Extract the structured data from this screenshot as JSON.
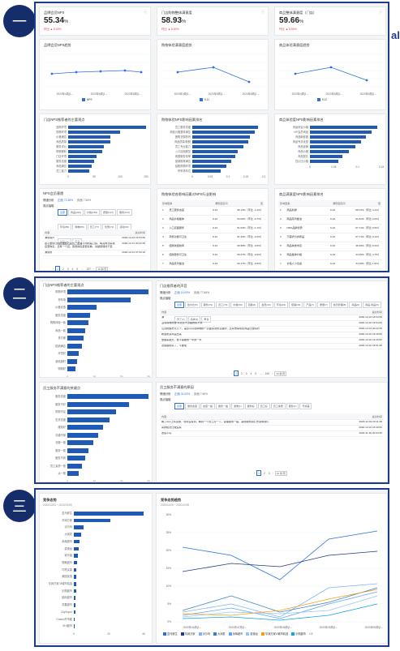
{
  "badges": [
    "一",
    "二",
    "三"
  ],
  "edge_glyph": "al",
  "s1": {
    "kpis": [
      {
        "title": "品牌会员NPS",
        "value": "55.34",
        "delta": "%",
        "change": "环比 ▲ 8.50%"
      },
      {
        "title": "门店购物整体满意度",
        "value": "58.93",
        "delta": "%",
        "change": "环比 ▲ 8.50%"
      },
      {
        "title": "商品整体满意度（门店）",
        "value": "59.66",
        "delta": "%",
        "change": "环比 ▲ 8.50%"
      }
    ],
    "trends": [
      {
        "title": "品牌会员NPS趋势",
        "legend": "NPS",
        "ticks": [
          "2020年4周(1...",
          "2020年6周(1...",
          "2020年8周(1..."
        ]
      },
      {
        "title": "购物体验满意度趋势",
        "legend": "9-10",
        "ticks": [
          "2020年4周(1...",
          "2020年6周(1...",
          "2020年8周(1..."
        ]
      },
      {
        "title": "商品体验满意度趋势",
        "legend": "9-10",
        "ticks": [
          "2020年4周(1...",
          "2020年6周(1...",
          "2020年8周(1..."
        ]
      }
    ],
    "bars": [
      {
        "title": "门店NPS推荐者的主要观点",
        "items": [
          {
            "l": "选购环境",
            "v": 100
          },
          {
            "l": "购物环境",
            "v": 67
          },
          {
            "l": "价格满意",
            "v": 54
          },
          {
            "l": "商品质量",
            "v": 54
          },
          {
            "l": "服务评价",
            "v": 46
          },
          {
            "l": "购物便利",
            "v": 44
          },
          {
            "l": "门店环境",
            "v": 36
          },
          {
            "l": "服务态度",
            "v": 33
          },
          {
            "l": "商品满意",
            "v": 30
          },
          {
            "l": "员工能力",
            "v": 27
          }
        ],
        "ticks": [
          "0",
          "50",
          "100",
          "150"
        ]
      },
      {
        "title": "购物体验NPS影响因素排名",
        "items": [
          {
            "l": "员工服务态度",
            "v": 92
          },
          {
            "l": "商品价格整体满意",
            "v": 88
          },
          {
            "l": "团购货架陈列",
            "v": 81
          },
          {
            "l": "商品质量/新鲜",
            "v": 78
          },
          {
            "l": "员工专业能力",
            "v": 72
          },
          {
            "l": "入口店面服务",
            "v": 64
          },
          {
            "l": "收银服务效率",
            "v": 60
          },
          {
            "l": "促销推荐满意",
            "v": 54
          },
          {
            "l": "结账购物环境",
            "v": 48
          },
          {
            "l": "停车场车位",
            "v": 40
          }
        ],
        "ticks": [
          "0",
          "0.05",
          "0.1",
          "0.15",
          "0.2"
        ]
      },
      {
        "title": "商品体验度NPS影响因素排名",
        "items": [
          {
            "l": "商品综合价格",
            "v": 94
          },
          {
            "l": "VIP会员商品",
            "v": 86
          },
          {
            "l": "商品新鲜度",
            "v": 78
          },
          {
            "l": "商品专享优惠",
            "v": 72
          },
          {
            "l": "商品促销",
            "v": 64
          },
          {
            "l": "商品价格",
            "v": 55
          },
          {
            "l": "商品配比",
            "v": 46
          },
          {
            "l": "性价比价格",
            "v": 40
          }
        ],
        "ticks": [
          "0",
          "0.05",
          "0.1",
          "0.15"
        ]
      }
    ],
    "voice": {
      "title": "NPS会员意愿",
      "radio_label": "情绪分析",
      "r1": "正面 72.38%",
      "r2": "负面 7.54%",
      "filter_label": "观点抽取",
      "tags": [
        "全部",
        "商品(224)",
        "价格(184)",
        "质量(127)",
        "服务(114)",
        "环境(89)",
        "购物(86)",
        "员工(77)",
        "优惠(72)",
        "活动(60)",
        "体验(54)",
        "更多"
      ],
      "headers": [
        "内容",
        "提交时间"
      ],
      "rows": [
        [
          "满意客户",
          "2020-12-03 19:53:36"
        ],
        [
          "最心爱的比利时国旗巧克力，最有不同的是口感，喝完再次来我店里购买，还有一个店，我觉得包装很好看，请继续保持不变",
          "2020-12-01 20:22:35"
        ],
        [
          "满意的",
          "2020-12-01 07:52:10"
        ]
      ],
      "pages": [
        "1",
        "2",
        "3",
        "4",
        "5",
        "...",
        "237"
      ],
      "page_size": "10 条/页"
    },
    "tables": [
      {
        "title": "购物体验各影响因素对NPS行业影响",
        "headers": [
          "影响因素",
          "满意度区间",
          "值"
        ],
        "rows": [
          [
            "1",
            "员工服务态度",
            "9-10",
            "55.13%（环比 -1.2%）"
          ],
          [
            "2",
            "商品价格整体",
            "9-10",
            "54.06%（环比 -0.7%）"
          ],
          [
            "3",
            "入口店面服务",
            "9-10",
            "51.63%（环比 -1.1%）"
          ],
          [
            "4",
            "商务功能可卫生",
            "9-10",
            "51.32%（环比 -2.0%）"
          ],
          [
            "5",
            "结账收银效率",
            "9-10",
            "50.98%（环比 -0.6%）"
          ],
          [
            "6",
            "结账服务可卫生",
            "9-10",
            "50.27%（环比 -0.9%）"
          ],
          [
            "7",
            "商品陈列整洁",
            "9-10",
            "50.17%（环比 -0.9%）"
          ]
        ]
      },
      {
        "title": "商品满意度NPS影响因素排名",
        "headers": [
          "影响因素",
          "满意度区间",
          "值"
        ],
        "rows": [
          [
            "1",
            "商品新鲜",
            "9-10",
            "68.72%（环比 4.1%）"
          ],
          [
            "2",
            "商品陈列整洁",
            "9-10",
            "61.82%（环比 2.0%）"
          ],
          [
            "3",
            "NMS品牌优势",
            "9-10",
            "67.71%（环比 0.9%）"
          ],
          [
            "4",
            "不需折价的商品",
            "9-10",
            "67.71%（环比 0.1%）"
          ],
          [
            "5",
            "商品种类丰富",
            "9-10",
            "46.46%（环比 6.4%）"
          ],
          [
            "6",
            "商品整体价格",
            "9-10",
            "44.40%（环比 4.7%）"
          ],
          [
            "7",
            "价格人小合适",
            "9-10",
            "34.18%（环比 1.5%）"
          ]
        ]
      }
    ]
  },
  "s2": {
    "bars": [
      {
        "title": "门店NPS推荐者的主要观点",
        "items": [
          {
            "l": "购物环境",
            "v": 100
          },
          {
            "l": "停车场",
            "v": 78
          },
          {
            "l": "价格优惠",
            "v": 36
          },
          {
            "l": "服务态度",
            "v": 28
          },
          {
            "l": "购物体验一致",
            "v": 26
          },
          {
            "l": "商品一致",
            "v": 22
          },
          {
            "l": "多方便",
            "v": 20
          },
          {
            "l": "促销满意",
            "v": 18
          },
          {
            "l": "环境好",
            "v": 14
          },
          {
            "l": "营收超时",
            "v": 12
          },
          {
            "l": "购物好",
            "v": 10
          }
        ],
        "ticks": [
          "0",
          "10",
          "20",
          "30"
        ]
      },
      {
        "title": "员工服务不满意的关键点",
        "items": [
          {
            "l": "服务态度",
            "v": 100
          },
          {
            "l": "服务不好",
            "v": 76
          },
          {
            "l": "购物不足",
            "v": 60
          },
          {
            "l": "售货态度",
            "v": 52
          },
          {
            "l": "服务好",
            "v": 44
          },
          {
            "l": "沟通不够",
            "v": 38
          },
          {
            "l": "流程一般",
            "v": 32
          },
          {
            "l": "服务一般",
            "v": 26
          },
          {
            "l": "服务不到",
            "v": 22
          },
          {
            "l": "员工素质一般",
            "v": 18
          },
          {
            "l": "太一般",
            "v": 14
          }
        ],
        "ticks": [
          "0",
          "10",
          "20",
          "30"
        ]
      }
    ],
    "voice1": {
      "title": "门店推荐者的声音",
      "radio_label": "情绪分析",
      "r1": "正面 14.93%",
      "r2": "负面 77.66%",
      "filter_label": "观点抽取",
      "tags": [
        "全部",
        "性价比(5)",
        "服务(73)",
        "员工(73)",
        "价格(59)",
        "自助(4)",
        "会员(16)",
        "环境(43)",
        "促销(39)",
        "产品(7)",
        "质量(7)",
        "会员管理(8)",
        "商品(6)",
        "商品-商品(5)",
        "员工(7)",
        "品牌(5)",
        "更多"
      ],
      "headers": [
        "内容",
        "提交时间"
      ],
      "rows": [
        [
          "满",
          "2020-12-02 18:53:36"
        ],
        [
          "没有购物质量 以及买不清楚的买不到",
          "2020-12-02 19:54:06"
        ],
        [
          "山顶的超市大几个，是否可以在购物的一点面多到更清楚的，还有觉得现在商品比较好的",
          "2020-12-01 20:22:35"
        ],
        [
          "希望更多商品出来",
          "2020-12-02 18:40:56"
        ],
        [
          "量越来越大，量不需要的一年的一半",
          "2020-12-02 19:40:52"
        ],
        [
          "这些都挺好了，不要啦",
          "2020-12-02 18:51:48"
        ]
      ],
      "pages": [
        "1",
        "2",
        "3",
        "4",
        "5",
        "...",
        "100"
      ],
      "page_size": "10 条/页"
    },
    "voice2": {
      "title": "员工服务不满意的原因",
      "radio_label": "情绪分析",
      "r1": "正面 31.63%",
      "r2": "负面 7.69%",
      "filter_label": "观点抽取",
      "tags": [
        "全部",
        "服务态度",
        "态度一般",
        "服务一般",
        "素质(1)",
        "服务好",
        "员工好",
        "员工素质",
        "服务(1)",
        "环境差"
      ],
      "headers": [
        "内容",
        "提交时间"
      ],
      "rows": [
        [
          "看了App上有兑换，现场没有到，看到一个员工问一下，说理服务一般，其他服务和打去说明我们",
          "2020-12-02 20:11:48"
        ],
        [
          "有的柜员比较没有",
          "2020-12-02 18:49:52"
        ],
        [
          "态度不好",
          "2020-11-30 20:03:36"
        ]
      ],
      "pages": [
        "1",
        "2",
        "3"
      ],
      "page_size": "10 条/页"
    }
  },
  "s3": {
    "bar": {
      "title": "竞争态势",
      "date": "2020/12/03 ~ 2020/12/09",
      "items": [
        {
          "l": "盒马鲜生",
          "v": 100
        },
        {
          "l": "华润万家",
          "v": 52
        },
        {
          "l": "沃尔玛",
          "v": 14
        },
        {
          "l": "大润发",
          "v": 10
        },
        {
          "l": "永辉超市",
          "v": 8
        },
        {
          "l": "麦德龙",
          "v": 7
        },
        {
          "l": "家乐福",
          "v": 6
        },
        {
          "l": "物美超市",
          "v": 5
        },
        {
          "l": "叮咚买菜",
          "v": 4
        },
        {
          "l": "美团优选",
          "v": 4
        },
        {
          "l": "华润万家-Vi城市精选",
          "v": 3
        },
        {
          "l": "乐购超市",
          "v": 3
        },
        {
          "l": "欧尚超市",
          "v": 2
        },
        {
          "l": "苏果超市",
          "v": 2
        },
        {
          "l": "CitySuper",
          "v": 2
        },
        {
          "l": "Costco开市客",
          "v": 1
        },
        {
          "l": "SHI超市",
          "v": 1
        }
      ],
      "ticks": [
        "0",
        "20",
        "40"
      ]
    },
    "line": {
      "title": "竞争态势趋势",
      "date": "2020/11/09 ~ 2020/12/09",
      "yticks": [
        "30%",
        "25%",
        "20%",
        "15%",
        "10%",
        "5%",
        "0%"
      ],
      "xticks": [
        "2020年44周(1...",
        "2020年47周(1...",
        "2020年48周(1...",
        "2020年49周(1...",
        "2020年50周(1..."
      ],
      "legend": [
        "盒马鲜生",
        "华润万家",
        "沃尔玛",
        "大润发",
        "永辉超市",
        "麦德龙",
        "华润万家Vi城市精选",
        "乐购超市"
      ],
      "page": "1/3"
    },
    "colors": [
      "#2f6fdd",
      "#1e3a8a",
      "#7fb3ff",
      "#3b82c4",
      "#60a5fa",
      "#93c5fd",
      "#f59e0b",
      "#0ea5e9"
    ]
  }
}
